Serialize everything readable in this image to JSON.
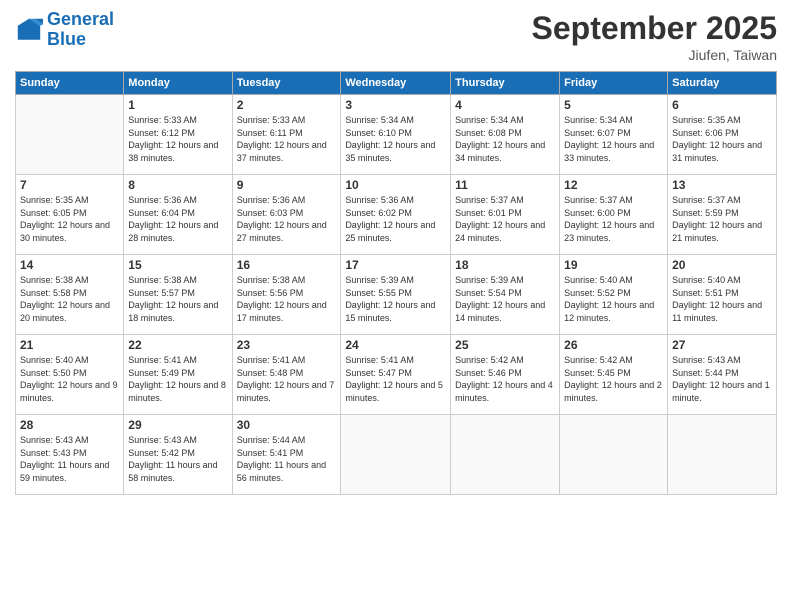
{
  "logo": {
    "line1": "General",
    "line2": "Blue"
  },
  "title": "September 2025",
  "location": "Jiufen, Taiwan",
  "days_of_week": [
    "Sunday",
    "Monday",
    "Tuesday",
    "Wednesday",
    "Thursday",
    "Friday",
    "Saturday"
  ],
  "weeks": [
    [
      {
        "day": "",
        "sunrise": "",
        "sunset": "",
        "daylight": ""
      },
      {
        "day": "1",
        "sunrise": "Sunrise: 5:33 AM",
        "sunset": "Sunset: 6:12 PM",
        "daylight": "Daylight: 12 hours and 38 minutes."
      },
      {
        "day": "2",
        "sunrise": "Sunrise: 5:33 AM",
        "sunset": "Sunset: 6:11 PM",
        "daylight": "Daylight: 12 hours and 37 minutes."
      },
      {
        "day": "3",
        "sunrise": "Sunrise: 5:34 AM",
        "sunset": "Sunset: 6:10 PM",
        "daylight": "Daylight: 12 hours and 35 minutes."
      },
      {
        "day": "4",
        "sunrise": "Sunrise: 5:34 AM",
        "sunset": "Sunset: 6:08 PM",
        "daylight": "Daylight: 12 hours and 34 minutes."
      },
      {
        "day": "5",
        "sunrise": "Sunrise: 5:34 AM",
        "sunset": "Sunset: 6:07 PM",
        "daylight": "Daylight: 12 hours and 33 minutes."
      },
      {
        "day": "6",
        "sunrise": "Sunrise: 5:35 AM",
        "sunset": "Sunset: 6:06 PM",
        "daylight": "Daylight: 12 hours and 31 minutes."
      }
    ],
    [
      {
        "day": "7",
        "sunrise": "Sunrise: 5:35 AM",
        "sunset": "Sunset: 6:05 PM",
        "daylight": "Daylight: 12 hours and 30 minutes."
      },
      {
        "day": "8",
        "sunrise": "Sunrise: 5:36 AM",
        "sunset": "Sunset: 6:04 PM",
        "daylight": "Daylight: 12 hours and 28 minutes."
      },
      {
        "day": "9",
        "sunrise": "Sunrise: 5:36 AM",
        "sunset": "Sunset: 6:03 PM",
        "daylight": "Daylight: 12 hours and 27 minutes."
      },
      {
        "day": "10",
        "sunrise": "Sunrise: 5:36 AM",
        "sunset": "Sunset: 6:02 PM",
        "daylight": "Daylight: 12 hours and 25 minutes."
      },
      {
        "day": "11",
        "sunrise": "Sunrise: 5:37 AM",
        "sunset": "Sunset: 6:01 PM",
        "daylight": "Daylight: 12 hours and 24 minutes."
      },
      {
        "day": "12",
        "sunrise": "Sunrise: 5:37 AM",
        "sunset": "Sunset: 6:00 PM",
        "daylight": "Daylight: 12 hours and 23 minutes."
      },
      {
        "day": "13",
        "sunrise": "Sunrise: 5:37 AM",
        "sunset": "Sunset: 5:59 PM",
        "daylight": "Daylight: 12 hours and 21 minutes."
      }
    ],
    [
      {
        "day": "14",
        "sunrise": "Sunrise: 5:38 AM",
        "sunset": "Sunset: 5:58 PM",
        "daylight": "Daylight: 12 hours and 20 minutes."
      },
      {
        "day": "15",
        "sunrise": "Sunrise: 5:38 AM",
        "sunset": "Sunset: 5:57 PM",
        "daylight": "Daylight: 12 hours and 18 minutes."
      },
      {
        "day": "16",
        "sunrise": "Sunrise: 5:38 AM",
        "sunset": "Sunset: 5:56 PM",
        "daylight": "Daylight: 12 hours and 17 minutes."
      },
      {
        "day": "17",
        "sunrise": "Sunrise: 5:39 AM",
        "sunset": "Sunset: 5:55 PM",
        "daylight": "Daylight: 12 hours and 15 minutes."
      },
      {
        "day": "18",
        "sunrise": "Sunrise: 5:39 AM",
        "sunset": "Sunset: 5:54 PM",
        "daylight": "Daylight: 12 hours and 14 minutes."
      },
      {
        "day": "19",
        "sunrise": "Sunrise: 5:40 AM",
        "sunset": "Sunset: 5:52 PM",
        "daylight": "Daylight: 12 hours and 12 minutes."
      },
      {
        "day": "20",
        "sunrise": "Sunrise: 5:40 AM",
        "sunset": "Sunset: 5:51 PM",
        "daylight": "Daylight: 12 hours and 11 minutes."
      }
    ],
    [
      {
        "day": "21",
        "sunrise": "Sunrise: 5:40 AM",
        "sunset": "Sunset: 5:50 PM",
        "daylight": "Daylight: 12 hours and 9 minutes."
      },
      {
        "day": "22",
        "sunrise": "Sunrise: 5:41 AM",
        "sunset": "Sunset: 5:49 PM",
        "daylight": "Daylight: 12 hours and 8 minutes."
      },
      {
        "day": "23",
        "sunrise": "Sunrise: 5:41 AM",
        "sunset": "Sunset: 5:48 PM",
        "daylight": "Daylight: 12 hours and 7 minutes."
      },
      {
        "day": "24",
        "sunrise": "Sunrise: 5:41 AM",
        "sunset": "Sunset: 5:47 PM",
        "daylight": "Daylight: 12 hours and 5 minutes."
      },
      {
        "day": "25",
        "sunrise": "Sunrise: 5:42 AM",
        "sunset": "Sunset: 5:46 PM",
        "daylight": "Daylight: 12 hours and 4 minutes."
      },
      {
        "day": "26",
        "sunrise": "Sunrise: 5:42 AM",
        "sunset": "Sunset: 5:45 PM",
        "daylight": "Daylight: 12 hours and 2 minutes."
      },
      {
        "day": "27",
        "sunrise": "Sunrise: 5:43 AM",
        "sunset": "Sunset: 5:44 PM",
        "daylight": "Daylight: 12 hours and 1 minute."
      }
    ],
    [
      {
        "day": "28",
        "sunrise": "Sunrise: 5:43 AM",
        "sunset": "Sunset: 5:43 PM",
        "daylight": "Daylight: 11 hours and 59 minutes."
      },
      {
        "day": "29",
        "sunrise": "Sunrise: 5:43 AM",
        "sunset": "Sunset: 5:42 PM",
        "daylight": "Daylight: 11 hours and 58 minutes."
      },
      {
        "day": "30",
        "sunrise": "Sunrise: 5:44 AM",
        "sunset": "Sunset: 5:41 PM",
        "daylight": "Daylight: 11 hours and 56 minutes."
      },
      {
        "day": "",
        "sunrise": "",
        "sunset": "",
        "daylight": ""
      },
      {
        "day": "",
        "sunrise": "",
        "sunset": "",
        "daylight": ""
      },
      {
        "day": "",
        "sunrise": "",
        "sunset": "",
        "daylight": ""
      },
      {
        "day": "",
        "sunrise": "",
        "sunset": "",
        "daylight": ""
      }
    ]
  ]
}
